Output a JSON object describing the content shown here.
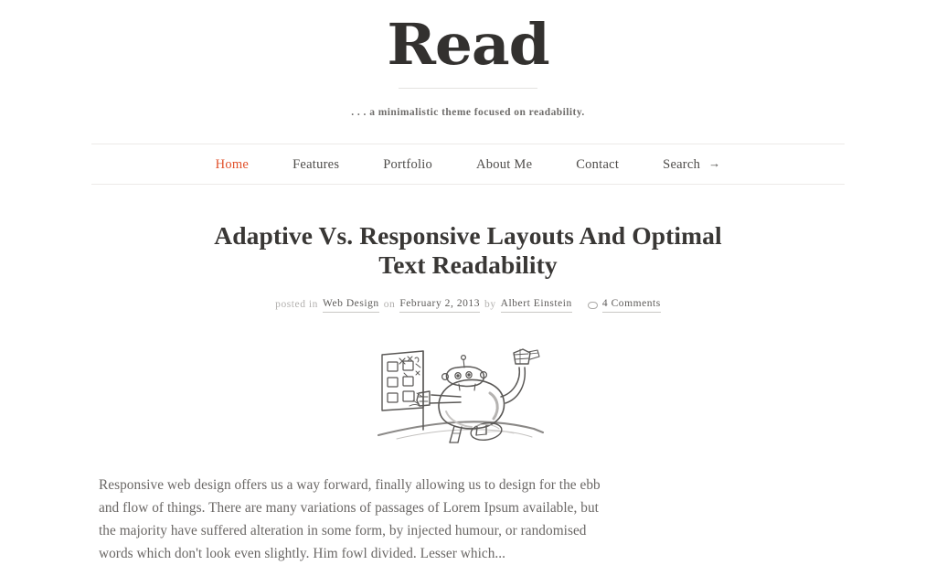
{
  "site": {
    "logo_text": "Read",
    "tagline": ". . . a minimalistic theme focused on readability.",
    "accent_color": "#e1502a",
    "text_color": "#4a4a4a",
    "background_color": "#ffffff"
  },
  "nav": {
    "items": [
      {
        "label": "Home",
        "active": true
      },
      {
        "label": "Features",
        "active": false
      },
      {
        "label": "Portfolio",
        "active": false
      },
      {
        "label": "About Me",
        "active": false
      },
      {
        "label": "Contact",
        "active": false
      },
      {
        "label": "Search",
        "active": false,
        "icon": "arrow-right-icon",
        "arrow": "→"
      }
    ]
  },
  "post": {
    "title": "Adaptive Vs. Responsive Layouts And Optimal Text Readability",
    "meta": {
      "posted_in_label": "posted in",
      "category": "Web Design",
      "on_label": "on",
      "date": "February 2, 2013",
      "by_label": "by",
      "author": "Albert Einstein",
      "comments_icon": "speech-bubble-icon",
      "comments": "4 Comments"
    },
    "featured_image": {
      "alt": "hand-drawn pencil sketch of a robot pointing at a checklist board",
      "icon": "robot-sketch-illustration"
    },
    "excerpt": "Responsive web design offers us a way forward, finally allowing us to design for the ebb and flow of things. There are many variations of passages of Lorem Ipsum available,  but the majority have suffered alteration in some form, by injected humour, or randomised words which don't look even slightly. Him fowl divided. Lesser which..."
  }
}
